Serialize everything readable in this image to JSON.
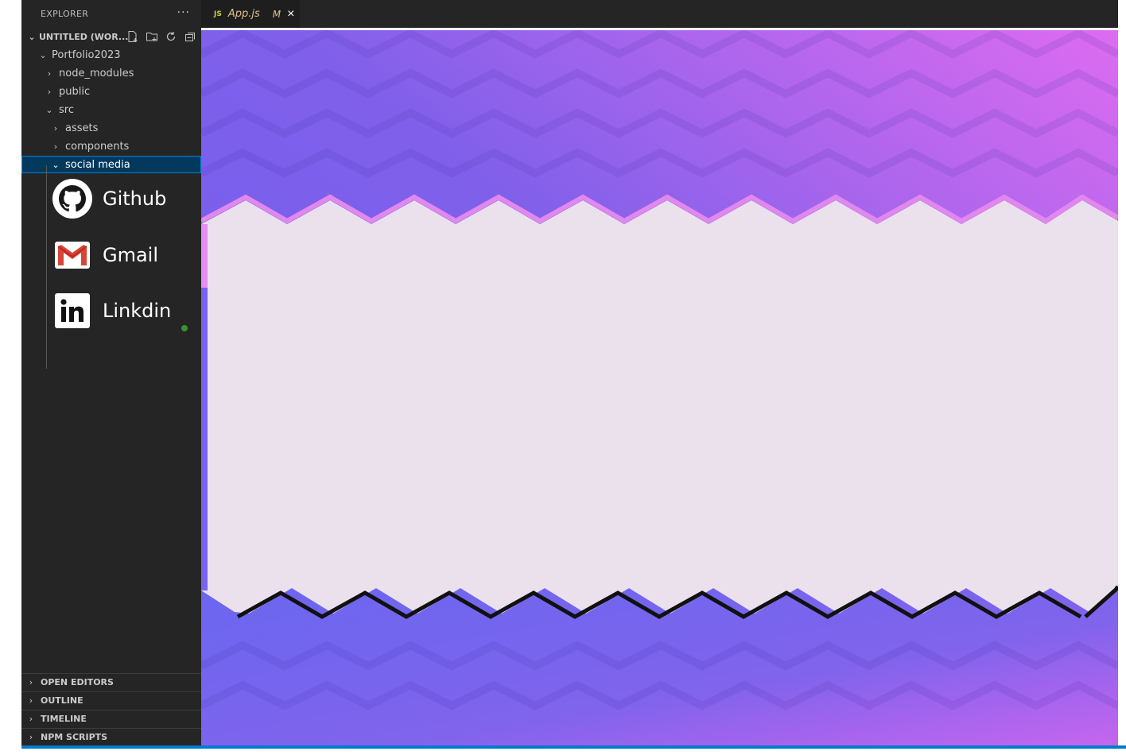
{
  "sidebar": {
    "header": "EXPLORER",
    "more": "···",
    "workspace": "UNTITLED (WOR...",
    "tree": [
      {
        "label": "Portfolio2023",
        "expanded": true
      },
      {
        "label": "node_modules",
        "expanded": false
      },
      {
        "label": "public",
        "expanded": false
      },
      {
        "label": "src",
        "expanded": true
      },
      {
        "label": "assets",
        "expanded": false
      },
      {
        "label": "components",
        "expanded": false
      },
      {
        "label": "social media",
        "expanded": true,
        "selected": true
      }
    ],
    "sections": [
      "OPEN EDITORS",
      "OUTLINE",
      "TIMELINE",
      "NPM SCRIPTS"
    ]
  },
  "social_links": [
    {
      "label": "Github",
      "icon": "github-icon"
    },
    {
      "label": "Gmail",
      "icon": "gmail-icon"
    },
    {
      "label": "Linkdin",
      "icon": "linkedin-icon"
    }
  ],
  "tab": {
    "lang": "JS",
    "filename": "App.js",
    "modified": "M",
    "close": "×"
  },
  "colors": {
    "sidebar_bg": "#252526",
    "selection_bg": "#04395e",
    "gradient_start": "#6a5ef0",
    "gradient_end": "#d96cf2",
    "content_panel": "#ebe1ed",
    "statusbar": "#007acc"
  }
}
